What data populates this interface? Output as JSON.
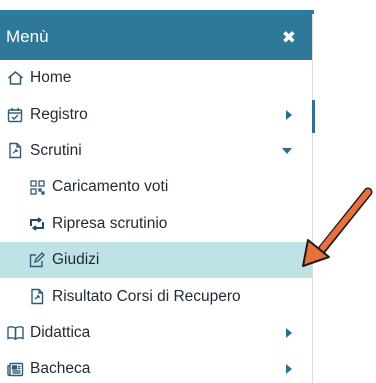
{
  "menu": {
    "title": "Menù",
    "close_symbol": "✖",
    "items": [
      {
        "label": "Home",
        "icon": "home-icon",
        "expanded": false,
        "has_caret": false,
        "active": false,
        "sub": false
      },
      {
        "label": "Registro",
        "icon": "calendar-check-icon",
        "has_caret": true,
        "caret": "right",
        "active": false,
        "sub": false
      },
      {
        "label": "Scrutini",
        "icon": "document-share-icon",
        "has_caret": true,
        "caret": "down",
        "active": false,
        "sub": false
      },
      {
        "label": "Caricamento voti",
        "icon": "grid-icon",
        "has_caret": false,
        "active": false,
        "sub": true
      },
      {
        "label": "Ripresa scrutinio",
        "icon": "retweet-icon",
        "has_caret": false,
        "active": false,
        "sub": true
      },
      {
        "label": "Giudizi",
        "icon": "edit-icon",
        "has_caret": false,
        "active": true,
        "sub": true
      },
      {
        "label": "Risultato Corsi di Recupero",
        "icon": "document-share-icon",
        "has_caret": false,
        "active": false,
        "sub": true
      },
      {
        "label": "Didattica",
        "icon": "book-open-icon",
        "has_caret": true,
        "caret": "right",
        "active": false,
        "sub": false
      },
      {
        "label": "Bacheca",
        "icon": "newspaper-icon",
        "has_caret": true,
        "caret": "right",
        "active": false,
        "sub": false
      }
    ]
  },
  "colors": {
    "header_bg": "#2e7898",
    "active_bg": "#bfe3e4",
    "arrow": "#e8703a"
  }
}
